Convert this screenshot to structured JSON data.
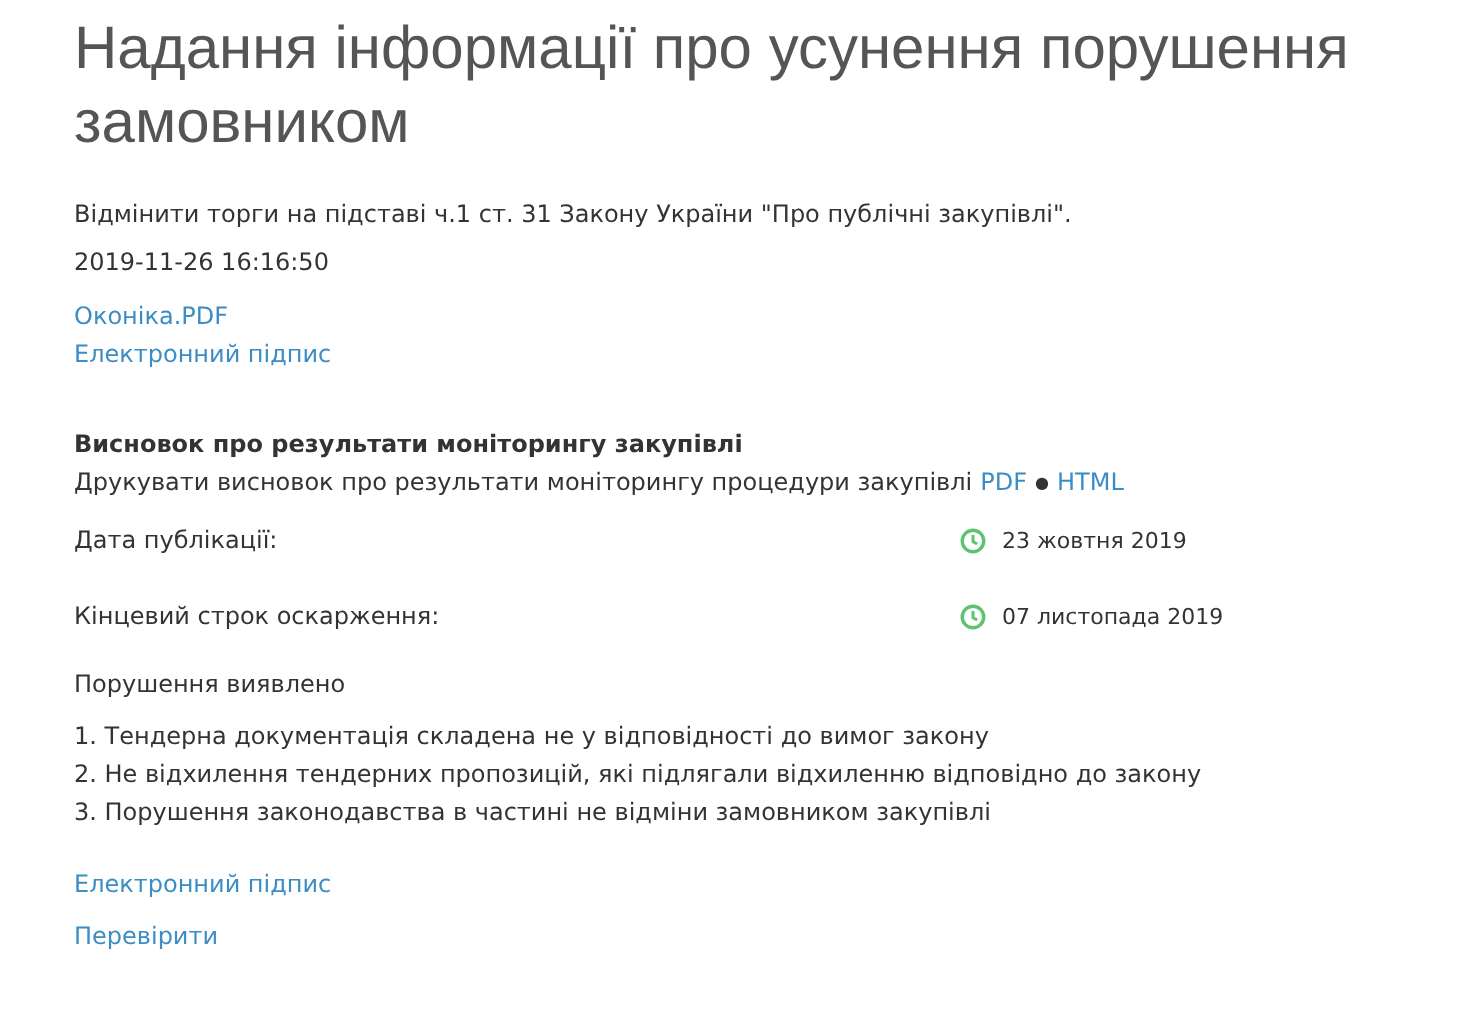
{
  "title": "Надання інформації про усунення порушення замовником",
  "description": "Відмінити торги на підставі ч.1 ст. 31 Закону України \"Про публічні закупівлі\".",
  "timestamp": "2019-11-26 16:16:50",
  "links": [
    "Оконіка.PDF",
    "Електронний підпис"
  ],
  "conclusion": {
    "heading": "Висновок про результати моніторингу закупівлі",
    "print_text": "Друкувати висновок про результати моніторингу процедури закупівлі",
    "print_links": [
      "PDF",
      "HTML"
    ],
    "separator": "●",
    "dates": [
      {
        "label": "Дата публікації:",
        "value": "23 жовтня 2019"
      },
      {
        "label": "Кінцевий строк оскарження:",
        "value": "07 листопада 2019"
      }
    ]
  },
  "violations": {
    "heading": "Порушення виявлено",
    "items": [
      "1. Тендерна документація складена не у відповідності до вимог закону",
      "2. Не відхилення тендерних пропозицій, які підлягали відхиленню відповідно до закону",
      "3. Порушення законодавства в частині не відміни замовником закупівлі"
    ]
  },
  "footer_links": [
    "Електронний підпис",
    "Перевірити"
  ]
}
